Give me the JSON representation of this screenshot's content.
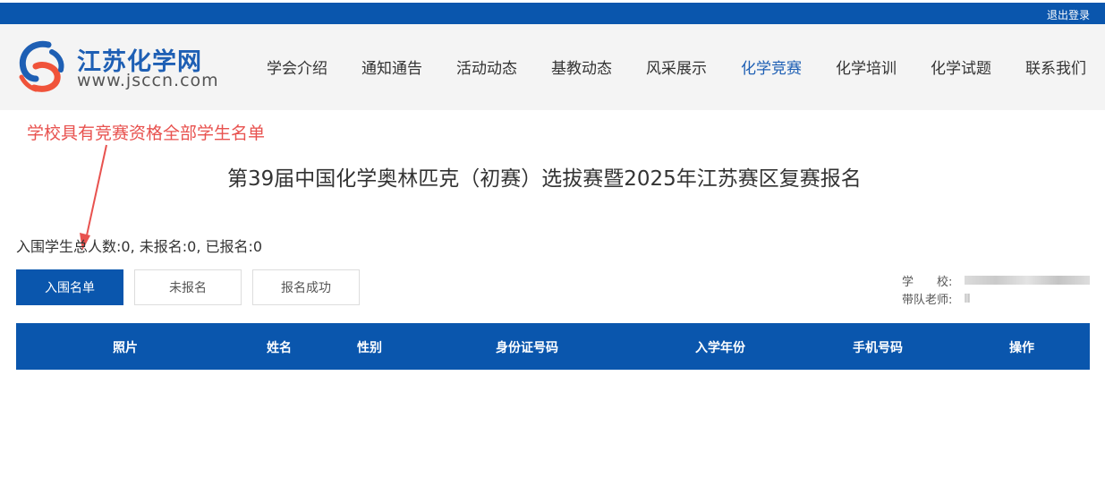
{
  "topbar": {
    "logout_label": "退出登录"
  },
  "header": {
    "site_name": "江苏化学网",
    "site_url": "www.jsccn.com",
    "nav": [
      {
        "label": "学会介绍"
      },
      {
        "label": "通知通告"
      },
      {
        "label": "活动动态"
      },
      {
        "label": "基教动态"
      },
      {
        "label": "风采展示"
      },
      {
        "label": "化学竞赛",
        "active": true
      },
      {
        "label": "化学培训"
      },
      {
        "label": "化学试题"
      },
      {
        "label": "联系我们"
      }
    ]
  },
  "annotation": {
    "text": "学校具有竞赛资格全部学生名单",
    "color": "#e8524f"
  },
  "page": {
    "title": "第39届中国化学奥林匹克（初赛）选拔赛暨2025年江苏赛区复赛报名",
    "stats": "入围学生总人数:0, 未报名:0, 已报名:0"
  },
  "tabs": [
    {
      "label": "入围名单",
      "active": true
    },
    {
      "label": "未报名"
    },
    {
      "label": "报名成功"
    }
  ],
  "school_info": {
    "school_label": "学　　校:",
    "teacher_label": "带队老师:"
  },
  "table": {
    "columns": [
      "照片",
      "姓名",
      "性别",
      "身份证号码",
      "入学年份",
      "手机号码",
      "操作"
    ]
  },
  "colors": {
    "primary": "#0a56ad",
    "accent": "#1e5fb4"
  }
}
